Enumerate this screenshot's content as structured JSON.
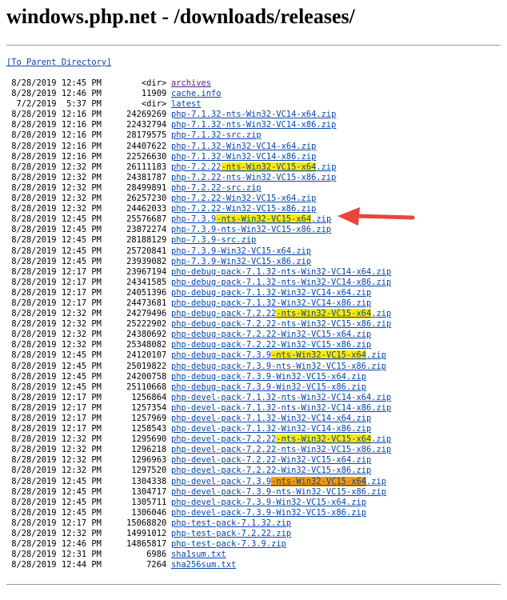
{
  "page": {
    "title": "windows.php.net - /downloads/releases/",
    "parent_link": "[To Parent Directory]"
  },
  "colors": {
    "link": "#0645ad",
    "visited": "#551a8b",
    "highlight": "#ffe900",
    "highlight_alt": "#ff9900",
    "arrow": "#e8453c"
  },
  "files": [
    {
      "date": "8/28/2019",
      "time": "12:45 PM",
      "size": "<dir>",
      "name": "archives",
      "visited": true
    },
    {
      "date": "8/28/2019",
      "time": "12:46 PM",
      "size": "11909",
      "name": "cache.info"
    },
    {
      "date": "7/2/2019",
      "time": "5:37 PM",
      "size": "<dir>",
      "name": "latest"
    },
    {
      "date": "8/28/2019",
      "time": "12:16 PM",
      "size": "24269269",
      "name": "php-7.1.32-nts-Win32-VC14-x64.zip"
    },
    {
      "date": "8/28/2019",
      "time": "12:16 PM",
      "size": "22432794",
      "name": "php-7.1.32-nts-Win32-VC14-x86.zip"
    },
    {
      "date": "8/28/2019",
      "time": "12:16 PM",
      "size": "28179575",
      "name": "php-7.1.32-src.zip"
    },
    {
      "date": "8/28/2019",
      "time": "12:16 PM",
      "size": "24407622",
      "name": "php-7.1.32-Win32-VC14-x64.zip"
    },
    {
      "date": "8/28/2019",
      "time": "12:16 PM",
      "size": "22526630",
      "name": "php-7.1.32-Win32-VC14-x86.zip"
    },
    {
      "date": "8/28/2019",
      "time": "12:32 PM",
      "size": "26111183",
      "name": "php-7.2.22-nts-Win32-VC15-x64.zip",
      "hl_prefix": "php-7.2.22",
      "hl_text": "-nts-Win32-VC15-x64",
      "hl_suffix": ".zip",
      "hl": "y"
    },
    {
      "date": "8/28/2019",
      "time": "12:32 PM",
      "size": "24381787",
      "name": "php-7.2.22-nts-Win32-VC15-x86.zip"
    },
    {
      "date": "8/28/2019",
      "time": "12:32 PM",
      "size": "28499891",
      "name": "php-7.2.22-src.zip"
    },
    {
      "date": "8/28/2019",
      "time": "12:32 PM",
      "size": "26257230",
      "name": "php-7.2.22-Win32-VC15-x64.zip"
    },
    {
      "date": "8/28/2019",
      "time": "12:32 PM",
      "size": "24462033",
      "name": "php-7.2.22-Win32-VC15-x86.zip"
    },
    {
      "date": "8/28/2019",
      "time": "12:45 PM",
      "size": "25576687",
      "name": "php-7.3.9-nts-Win32-VC15-x64.zip",
      "hl_prefix": "php-7.3.9",
      "hl_text": "-nts-Win32-VC15-x64",
      "hl_suffix": ".zip",
      "hl": "y"
    },
    {
      "date": "8/28/2019",
      "time": "12:45 PM",
      "size": "23872274",
      "name": "php-7.3.9-nts-Win32-VC15-x86.zip"
    },
    {
      "date": "8/28/2019",
      "time": "12:45 PM",
      "size": "28188129",
      "name": "php-7.3.9-src.zip"
    },
    {
      "date": "8/28/2019",
      "time": "12:45 PM",
      "size": "25720841",
      "name": "php-7.3.9-Win32-VC15-x64.zip"
    },
    {
      "date": "8/28/2019",
      "time": "12:45 PM",
      "size": "23939082",
      "name": "php-7.3.9-Win32-VC15-x86.zip"
    },
    {
      "date": "8/28/2019",
      "time": "12:17 PM",
      "size": "23967194",
      "name": "php-debug-pack-7.1.32-nts-Win32-VC14-x64.zip"
    },
    {
      "date": "8/28/2019",
      "time": "12:17 PM",
      "size": "24341585",
      "name": "php-debug-pack-7.1.32-nts-Win32-VC14-x86.zip"
    },
    {
      "date": "8/28/2019",
      "time": "12:17 PM",
      "size": "24051396",
      "name": "php-debug-pack-7.1.32-Win32-VC14-x64.zip"
    },
    {
      "date": "8/28/2019",
      "time": "12:17 PM",
      "size": "24473681",
      "name": "php-debug-pack-7.1.32-Win32-VC14-x86.zip"
    },
    {
      "date": "8/28/2019",
      "time": "12:32 PM",
      "size": "24279496",
      "name": "php-debug-pack-7.2.22-nts-Win32-VC15-x64.zip",
      "hl_prefix": "php-debug-pack-7.2.22",
      "hl_text": "-nts-Win32-VC15-x64",
      "hl_suffix": ".zip",
      "hl": "y"
    },
    {
      "date": "8/28/2019",
      "time": "12:32 PM",
      "size": "25222902",
      "name": "php-debug-pack-7.2.22-nts-Win32-VC15-x86.zip"
    },
    {
      "date": "8/28/2019",
      "time": "12:32 PM",
      "size": "24380692",
      "name": "php-debug-pack-7.2.22-Win32-VC15-x64.zip"
    },
    {
      "date": "8/28/2019",
      "time": "12:32 PM",
      "size": "25348082",
      "name": "php-debug-pack-7.2.22-Win32-VC15-x86.zip"
    },
    {
      "date": "8/28/2019",
      "time": "12:45 PM",
      "size": "24120107",
      "name": "php-debug-pack-7.3.9-nts-Win32-VC15-x64.zip",
      "hl_prefix": "php-debug-pack-7.3.9",
      "hl_text": "-nts-Win32-VC15-x64",
      "hl_suffix": ".zip",
      "hl": "y"
    },
    {
      "date": "8/28/2019",
      "time": "12:45 PM",
      "size": "25019822",
      "name": "php-debug-pack-7.3.9-nts-Win32-VC15-x86.zip"
    },
    {
      "date": "8/28/2019",
      "time": "12:45 PM",
      "size": "24200758",
      "name": "php-debug-pack-7.3.9-Win32-VC15-x64.zip"
    },
    {
      "date": "8/28/2019",
      "time": "12:45 PM",
      "size": "25110668",
      "name": "php-debug-pack-7.3.9-Win32-VC15-x86.zip"
    },
    {
      "date": "8/28/2019",
      "time": "12:17 PM",
      "size": "1256864",
      "name": "php-devel-pack-7.1.32-nts-Win32-VC14-x64.zip"
    },
    {
      "date": "8/28/2019",
      "time": "12:17 PM",
      "size": "1257354",
      "name": "php-devel-pack-7.1.32-nts-Win32-VC14-x86.zip"
    },
    {
      "date": "8/28/2019",
      "time": "12:17 PM",
      "size": "1257969",
      "name": "php-devel-pack-7.1.32-Win32-VC14-x64.zip"
    },
    {
      "date": "8/28/2019",
      "time": "12:17 PM",
      "size": "1258543",
      "name": "php-devel-pack-7.1.32-Win32-VC14-x86.zip"
    },
    {
      "date": "8/28/2019",
      "time": "12:32 PM",
      "size": "1295690",
      "name": "php-devel-pack-7.2.22-nts-Win32-VC15-x64.zip",
      "hl_prefix": "php-devel-pack-7.2.22",
      "hl_text": "-nts-Win32-VC15-x64",
      "hl_suffix": ".zip",
      "hl": "y"
    },
    {
      "date": "8/28/2019",
      "time": "12:32 PM",
      "size": "1296218",
      "name": "php-devel-pack-7.2.22-nts-Win32-VC15-x86.zip"
    },
    {
      "date": "8/28/2019",
      "time": "12:32 PM",
      "size": "1296963",
      "name": "php-devel-pack-7.2.22-Win32-VC15-x64.zip"
    },
    {
      "date": "8/28/2019",
      "time": "12:32 PM",
      "size": "1297520",
      "name": "php-devel-pack-7.2.22-Win32-VC15-x86.zip"
    },
    {
      "date": "8/28/2019",
      "time": "12:45 PM",
      "size": "1304338",
      "name": "php-devel-pack-7.3.9-nts-Win32-VC15-x64.zip",
      "hl_prefix": "php-devel-pack-7.3.9",
      "hl_text": "-nts-Win32-VC15-x64",
      "hl_suffix": ".zip",
      "hl": "o"
    },
    {
      "date": "8/28/2019",
      "time": "12:45 PM",
      "size": "1304717",
      "name": "php-devel-pack-7.3.9-nts-Win32-VC15-x86.zip"
    },
    {
      "date": "8/28/2019",
      "time": "12:45 PM",
      "size": "1305711",
      "name": "php-devel-pack-7.3.9-Win32-VC15-x64.zip"
    },
    {
      "date": "8/28/2019",
      "time": "12:45 PM",
      "size": "1306046",
      "name": "php-devel-pack-7.3.9-Win32-VC15-x86.zip"
    },
    {
      "date": "8/28/2019",
      "time": "12:17 PM",
      "size": "15068820",
      "name": "php-test-pack-7.1.32.zip"
    },
    {
      "date": "8/28/2019",
      "time": "12:32 PM",
      "size": "14991012",
      "name": "php-test-pack-7.2.22.zip"
    },
    {
      "date": "8/28/2019",
      "time": "12:46 PM",
      "size": "14865817",
      "name": "php-test-pack-7.3.9.zip"
    },
    {
      "date": "8/28/2019",
      "time": "12:31 PM",
      "size": "6986",
      "name": "sha1sum.txt"
    },
    {
      "date": "8/28/2019",
      "time": "12:44 PM",
      "size": "7264",
      "name": "sha256sum.txt"
    }
  ]
}
